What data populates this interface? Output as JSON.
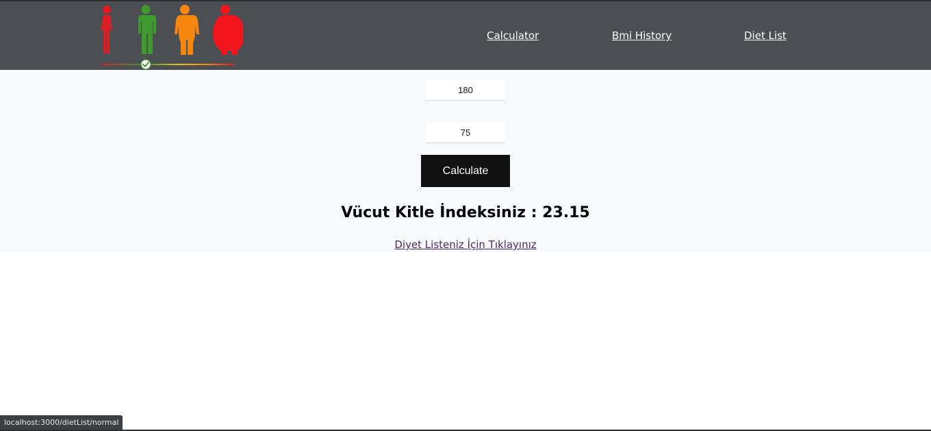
{
  "nav": {
    "logo_icon": "bmi-body-shapes-logo",
    "links": [
      "Calculator",
      "Bmi History",
      "Diet List"
    ]
  },
  "form": {
    "height_value": "180",
    "weight_value": "75",
    "calculate_label": "Calculate"
  },
  "result": {
    "text": "Vücut Kitle İndeksiniz : 23.15"
  },
  "diet_link": {
    "text": "Diyet Listeniz İçin Tıklayınız"
  },
  "status_bar": {
    "url": "localhost:3000/dietList/normal"
  },
  "colors": {
    "navbar": "#4b4f54",
    "content_bg": "#f8f9fd",
    "button": "#111111",
    "figure_underweight": "#e01b22",
    "figure_normal": "#3e9a2c",
    "figure_overweight": "#f7860f",
    "figure_obese": "#f2161c"
  }
}
